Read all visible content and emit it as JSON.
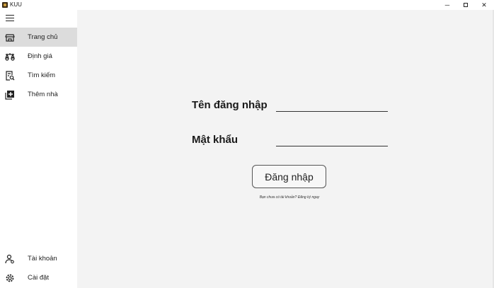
{
  "window": {
    "title": "KUU",
    "minimize_glyph": "─",
    "close_glyph": "✕"
  },
  "sidebar": {
    "items": [
      {
        "label": "Trang chủ",
        "icon": "store-icon",
        "active": true
      },
      {
        "label": "Định giá",
        "icon": "scale-icon",
        "active": false
      },
      {
        "label": "Tìm kiếm",
        "icon": "search-doc-icon",
        "active": false
      },
      {
        "label": "Thêm nhà",
        "icon": "add-box-icon",
        "active": false
      }
    ],
    "bottom_items": [
      {
        "label": "Tài khoản",
        "icon": "account-icon"
      },
      {
        "label": "Cài đặt",
        "icon": "settings-icon"
      }
    ]
  },
  "login": {
    "username_label": "Tên đăng nhập",
    "username_value": "",
    "password_label": "Mật khẩu",
    "password_value": "",
    "submit_label": "Đăng nhập",
    "signup_prompt": "Bạn chưa có tài khoản? Đăng ký ngay"
  },
  "colors": {
    "main_background": "#f3f3f3",
    "sidebar_background": "#ffffff",
    "active_item": "#dcdcdc"
  }
}
